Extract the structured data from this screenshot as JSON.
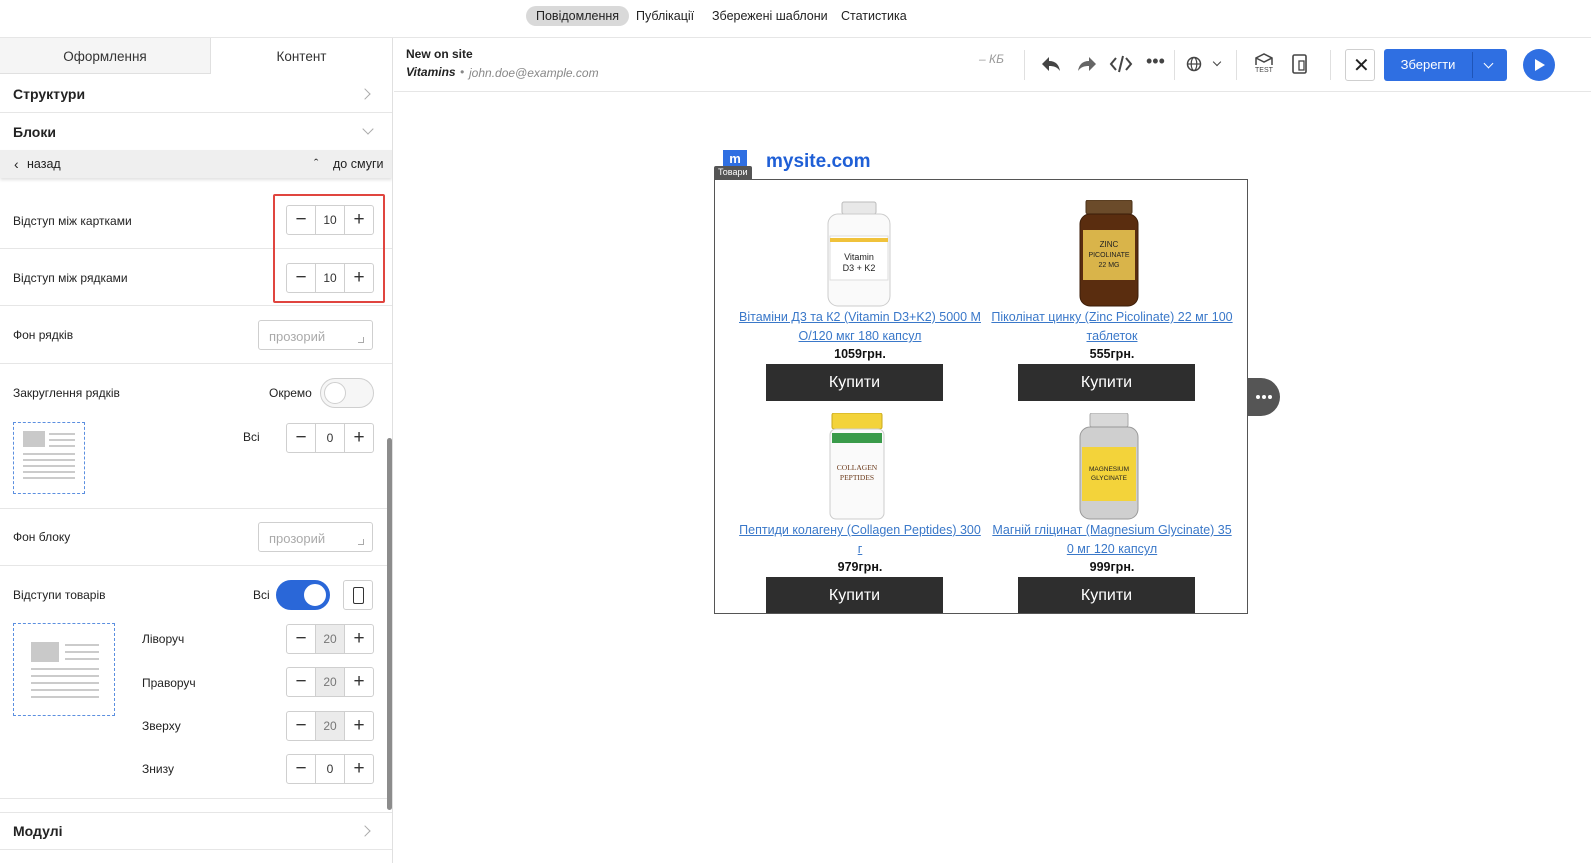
{
  "top_nav": {
    "tabs": [
      {
        "label": "Повідомлення",
        "active": true
      },
      {
        "label": "Публікації",
        "active": false
      },
      {
        "label": "Збережені шаблони",
        "active": false
      },
      {
        "label": "Статистика",
        "active": false
      }
    ]
  },
  "left_panel": {
    "tabs": {
      "design": "Оформлення",
      "content": "Контент"
    },
    "sections": {
      "structures": "Структури",
      "blocks": "Блоки",
      "modules": "Модулі"
    },
    "back": {
      "back_label": "назад",
      "to_strip_label": "до смуги"
    },
    "settings": {
      "card_gap": {
        "label": "Відступ між картками",
        "value": "10"
      },
      "row_gap": {
        "label": "Відступ між рядками",
        "value": "10"
      },
      "row_bg": {
        "label": "Фон рядків",
        "placeholder": "прозорий"
      },
      "row_rounding": {
        "label": "Закруглення рядків",
        "toggle_label": "Окремо",
        "all_label": "Всі",
        "all_value": "0"
      },
      "block_bg": {
        "label": "Фон блоку",
        "placeholder": "прозорий"
      },
      "product_padding": {
        "label": "Відступи товарів",
        "all_label": "Всі",
        "left": {
          "label": "Ліворуч",
          "value": "20"
        },
        "right": {
          "label": "Праворуч",
          "value": "20"
        },
        "top": {
          "label": "Зверху",
          "value": "20"
        },
        "bottom": {
          "label": "Знизу",
          "value": "0"
        }
      }
    }
  },
  "editor_bar": {
    "message_name": "New on site",
    "subject": "Vitamins",
    "sender": "john.doe@example.com",
    "size": "– КБ",
    "test_label": "TEST",
    "save_label": "Зберегти"
  },
  "canvas": {
    "site_logo_letter": "m",
    "site_name": "mysite.com",
    "block_badge": "Товари",
    "products": [
      {
        "title_line1": "Вітаміни Д3 та К2 (Vitamin D3+K2) 5000 М",
        "title_line2": "О/120 мкг 180 капсул",
        "price": "1059грн.",
        "buy": "Купити"
      },
      {
        "title_line1": "Піколінат цинку (Zinc Picolinate) 22 мг 100",
        "title_line2": "таблеток",
        "price": "555грн.",
        "buy": "Купити"
      },
      {
        "title_line1": "Пептиди колагену (Collagen Peptides) 300",
        "title_line2": "г",
        "price": "979грн.",
        "buy": "Купити"
      },
      {
        "title_line1": "Магній гліцинат (Magnesium Glycinate) 35",
        "title_line2": "0 мг 120 капсул",
        "price": "999грн.",
        "buy": "Купити"
      }
    ],
    "bottle_labels": [
      {
        "line1": "Vitamin",
        "line2": "D3 + K2"
      },
      {
        "line1": "ZINC",
        "line2": "PICOLINATE",
        "line3": "22 MG"
      },
      {
        "line1": "COLLAGEN",
        "line2": "PEPTIDES"
      },
      {
        "line1": "MAGNESIUM",
        "line2": "GLYCINATE"
      }
    ]
  },
  "colors": {
    "accent": "#2a67d8",
    "save_button": "#2f6fe2",
    "link": "#3a78c9",
    "buy_button": "#2e2e2e",
    "highlight": "#e0453f"
  }
}
